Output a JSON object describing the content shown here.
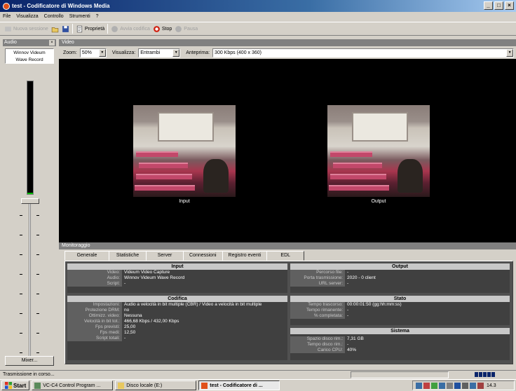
{
  "window": {
    "title": "test - Codificatore di Windows Media"
  },
  "menu": [
    "File",
    "Visualizza",
    "Controllo",
    "Strumenti",
    "?"
  ],
  "toolbar": {
    "new_session": "Nuova sessione",
    "properties": "Proprietà",
    "start_encoding": "Avvia codifica",
    "stop": "Stop",
    "pause": "Pausa"
  },
  "audio": {
    "panel_title": "Audio",
    "device_line1": "Winnov Videum",
    "device_line2": "Wave Record",
    "mixer_label": "Mixer..."
  },
  "video": {
    "panel_title": "Video",
    "zoom_label": "Zoom:",
    "zoom_value": "50%",
    "view_label": "Visualizza:",
    "view_value": "Entrambi",
    "preview_label": "Anteprima:",
    "preview_value": "300 Kbps (400 x 360)",
    "input_caption": "Input",
    "output_caption": "Output"
  },
  "monitor": {
    "panel_title": "Monitoraggio",
    "tabs": [
      "Generale",
      "Statistiche",
      "Server",
      "Connessioni",
      "Registro eventi",
      "EDL"
    ],
    "input": {
      "title": "Input",
      "rows": [
        {
          "label": "Video:",
          "value": "Videum Video Capture"
        },
        {
          "label": "Audio:",
          "value": "Winnov Videum Wave Record"
        },
        {
          "label": "Script:",
          "value": "-"
        }
      ]
    },
    "encoding": {
      "title": "Codifica",
      "rows": [
        {
          "label": "Impostazioni:",
          "value": "Audio a velocità in bit multiple (CBR) / Video a velocità in bit multiple"
        },
        {
          "label": "Protezione DRM:",
          "value": "no"
        },
        {
          "label": "Ottimizz. video:",
          "value": "Nessuna"
        },
        {
          "label": "Velocità in bit tot.:",
          "value": "466,68 Kbps / 432,00 Kbps"
        },
        {
          "label": "Fps previsti:",
          "value": "25,00"
        },
        {
          "label": "Fps medi:",
          "value": "12,50"
        },
        {
          "label": "Script totali:",
          "value": "-"
        }
      ]
    },
    "output": {
      "title": "Output",
      "rows": [
        {
          "label": "Percorso file:",
          "value": "-"
        },
        {
          "label": "Porta trasmissione:",
          "value": "2020 - 0 client"
        },
        {
          "label": "URL server:",
          "value": "-"
        }
      ]
    },
    "state": {
      "title": "Stato",
      "rows": [
        {
          "label": "Tempo trascorso:",
          "value": "00:00:01:50  (gg:hh:mm:ss)"
        },
        {
          "label": "Tempo rimanente:",
          "value": "-"
        },
        {
          "label": "% completata:",
          "value": "-"
        }
      ]
    },
    "system": {
      "title": "Sistema",
      "rows": [
        {
          "label": "Spazio disco rim.:",
          "value": "7,31 GB"
        },
        {
          "label": "Tempo disco rim.:",
          "value": "-"
        },
        {
          "label": "Carico CPU:",
          "value": "40%"
        }
      ]
    }
  },
  "status": {
    "text": "Trasmissione in corso..."
  },
  "taskbar": {
    "start": "Start",
    "tasks": [
      "VC-C4 Control Program ...",
      "Disco locale (E:)",
      "test - Codificatore di ..."
    ],
    "clock": "14.3"
  }
}
